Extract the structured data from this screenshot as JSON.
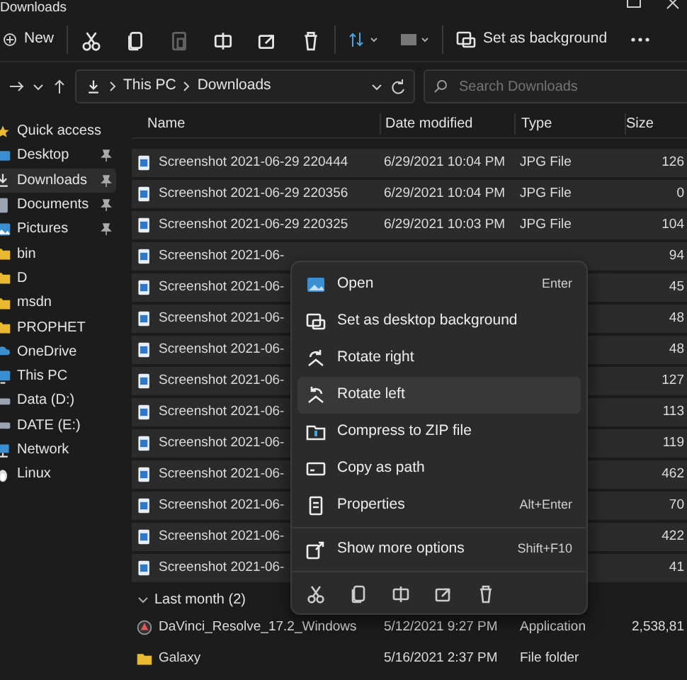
{
  "window": {
    "title": "Downloads"
  },
  "toolbar": {
    "new_label": "New",
    "set_background_label": "Set as background",
    "items": [
      {
        "kind": "cut",
        "disabled": false
      },
      {
        "kind": "copy",
        "disabled": false
      },
      {
        "kind": "paste",
        "disabled": true
      },
      {
        "kind": "rename",
        "disabled": false
      },
      {
        "kind": "share",
        "disabled": false
      },
      {
        "kind": "delete",
        "disabled": false
      }
    ]
  },
  "address_bar": {
    "path": [
      "This PC",
      "Downloads"
    ],
    "search_placeholder": "Search Downloads"
  },
  "sidebar": {
    "items": [
      {
        "label": "Quick access",
        "kind": "star",
        "pinned": false,
        "selected": false
      },
      {
        "label": "Desktop",
        "kind": "desktop",
        "pinned": true,
        "selected": false
      },
      {
        "label": "Downloads",
        "kind": "download",
        "pinned": true,
        "selected": true
      },
      {
        "label": "Documents",
        "kind": "document",
        "pinned": true,
        "selected": false
      },
      {
        "label": "Pictures",
        "kind": "picture",
        "pinned": true,
        "selected": false
      },
      {
        "label": "bin",
        "kind": "folder",
        "pinned": false,
        "selected": false
      },
      {
        "label": "D",
        "kind": "folder",
        "pinned": false,
        "selected": false
      },
      {
        "label": "msdn",
        "kind": "folder",
        "pinned": false,
        "selected": false
      },
      {
        "label": "PROPHET",
        "kind": "folder",
        "pinned": false,
        "selected": false
      },
      {
        "label": "OneDrive",
        "kind": "cloud",
        "pinned": false,
        "selected": false
      },
      {
        "label": "This PC",
        "kind": "pc",
        "pinned": false,
        "selected": false
      },
      {
        "label": "Data (D:)",
        "kind": "drive",
        "pinned": false,
        "selected": false
      },
      {
        "label": "DATE (E:)",
        "kind": "drive",
        "pinned": false,
        "selected": false
      },
      {
        "label": "Network",
        "kind": "network",
        "pinned": false,
        "selected": false
      },
      {
        "label": "Linux",
        "kind": "linux",
        "pinned": false,
        "selected": false
      }
    ]
  },
  "table": {
    "columns": [
      "Name",
      "Date modified",
      "Type",
      "Size"
    ],
    "groups": [
      {
        "rows": [
          {
            "name": "Screenshot 2021-06-29 220444",
            "date": "6/29/2021 10:04 PM",
            "type": "JPG File",
            "size": "126",
            "kind": "image",
            "selected": true
          },
          {
            "name": "Screenshot 2021-06-29 220356",
            "date": "6/29/2021 10:04 PM",
            "type": "JPG File",
            "size": "0",
            "kind": "image",
            "selected": true
          },
          {
            "name": "Screenshot 2021-06-29 220325",
            "date": "6/29/2021 10:03 PM",
            "type": "JPG File",
            "size": "104",
            "kind": "image",
            "selected": true
          },
          {
            "name": "Screenshot 2021-06-",
            "size": "94",
            "kind": "image",
            "selected": true
          },
          {
            "name": "Screenshot 2021-06-",
            "size": "45",
            "kind": "image",
            "selected": true
          },
          {
            "name": "Screenshot 2021-06-",
            "size": "48",
            "kind": "image",
            "selected": true
          },
          {
            "name": "Screenshot 2021-06-",
            "size": "48",
            "kind": "image",
            "selected": true
          },
          {
            "name": "Screenshot 2021-06-",
            "size": "127",
            "kind": "image",
            "selected": true
          },
          {
            "name": "Screenshot 2021-06-",
            "size": "113",
            "kind": "image",
            "selected": true
          },
          {
            "name": "Screenshot 2021-06-",
            "size": "119",
            "kind": "image",
            "selected": true
          },
          {
            "name": "Screenshot 2021-06-",
            "size": "462",
            "kind": "image",
            "selected": true
          },
          {
            "name": "Screenshot 2021-06-",
            "size": "70",
            "kind": "image",
            "selected": true
          },
          {
            "name": "Screenshot 2021-06-",
            "size": "422",
            "kind": "image",
            "selected": true
          },
          {
            "name": "Screenshot 2021-06-",
            "size": "41",
            "kind": "image",
            "selected": true
          }
        ]
      },
      {
        "label": "Last month (2)",
        "rows": [
          {
            "name": "DaVinci_Resolve_17.2_Windows",
            "date": "5/12/2021 9:27 PM",
            "type": "Application",
            "size": "2,538,81",
            "kind": "app",
            "selected": false
          },
          {
            "name": "Galaxy",
            "date": "5/16/2021 2:37 PM",
            "type": "File folder",
            "kind": "folder",
            "selected": false
          }
        ]
      }
    ]
  },
  "context_menu": {
    "items": [
      {
        "label": "Open",
        "shortcut": "Enter",
        "kind": "open",
        "hovered": false
      },
      {
        "label": "Set as desktop background",
        "kind": "background",
        "hovered": false
      },
      {
        "label": "Rotate right",
        "kind": "rotate-right",
        "hovered": false
      },
      {
        "label": "Rotate left",
        "kind": "rotate-left",
        "hovered": true
      },
      {
        "label": "Compress to ZIP file",
        "kind": "zip",
        "hovered": false
      },
      {
        "label": "Copy as path",
        "kind": "path",
        "hovered": false
      },
      {
        "label": "Properties",
        "shortcut": "Alt+Enter",
        "kind": "properties",
        "hovered": false
      },
      {
        "label": "Show more options",
        "shortcut": "Shift+F10",
        "kind": "more",
        "hovered": false
      }
    ],
    "actions": [
      {
        "kind": "cut"
      },
      {
        "kind": "copy"
      },
      {
        "kind": "rename"
      },
      {
        "kind": "share"
      },
      {
        "kind": "delete"
      }
    ]
  }
}
